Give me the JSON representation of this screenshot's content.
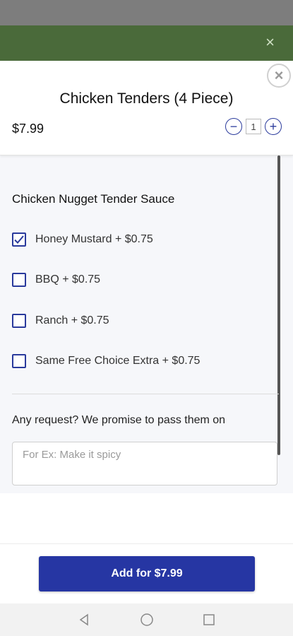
{
  "top_banner": {
    "close_glyph": "×"
  },
  "header": {
    "close_glyph": "×",
    "title": "Chicken Tenders (4 Piece)",
    "price": "$7.99",
    "quantity": {
      "minus": "−",
      "value": "1",
      "plus": "+"
    }
  },
  "sauces": {
    "title": "Chicken Nugget Tender Sauce",
    "options": [
      {
        "label": "Honey Mustard + $0.75",
        "checked": true
      },
      {
        "label": "BBQ + $0.75",
        "checked": false
      },
      {
        "label": "Ranch + $0.75",
        "checked": false
      },
      {
        "label": "Same Free Choice Extra + $0.75",
        "checked": false
      }
    ]
  },
  "request": {
    "label": "Any request? We promise to pass them on",
    "placeholder": "For Ex: Make it spicy",
    "value": ""
  },
  "footer": {
    "add_button_label": "Add for $7.99"
  },
  "colors": {
    "accent": "#2636a3",
    "banner": "#4a6a3a"
  },
  "nav": {
    "icons": [
      "back-triangle-icon",
      "home-circle-icon",
      "recents-square-icon"
    ]
  }
}
